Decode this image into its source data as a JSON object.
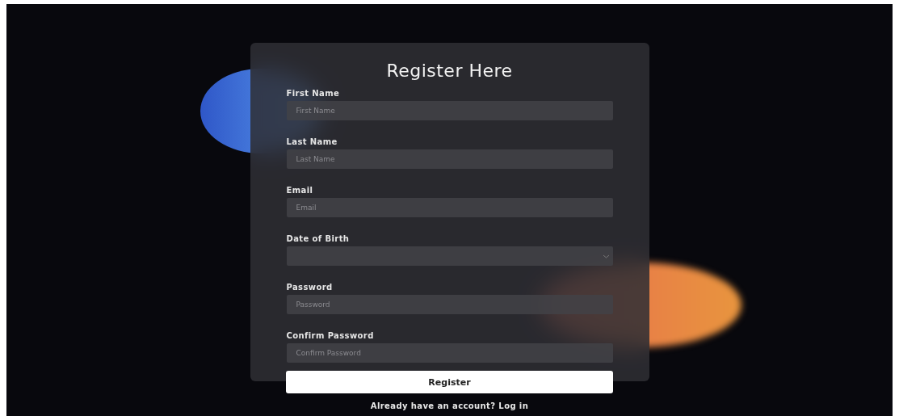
{
  "form": {
    "title": "Register Here",
    "fields": [
      {
        "label": "First Name",
        "placeholder": "First Name",
        "kind": "text"
      },
      {
        "label": "Last Name",
        "placeholder": "Last Name",
        "kind": "text"
      },
      {
        "label": "Email",
        "placeholder": "Email",
        "kind": "text"
      },
      {
        "label": "Date of Birth",
        "kind": "date"
      },
      {
        "label": "Password",
        "placeholder": "Password",
        "kind": "password"
      },
      {
        "label": "Confirm Password",
        "placeholder": "Confirm Password",
        "kind": "password"
      }
    ],
    "submit": "Register",
    "login_prompt": "Already have an account? Log in"
  }
}
